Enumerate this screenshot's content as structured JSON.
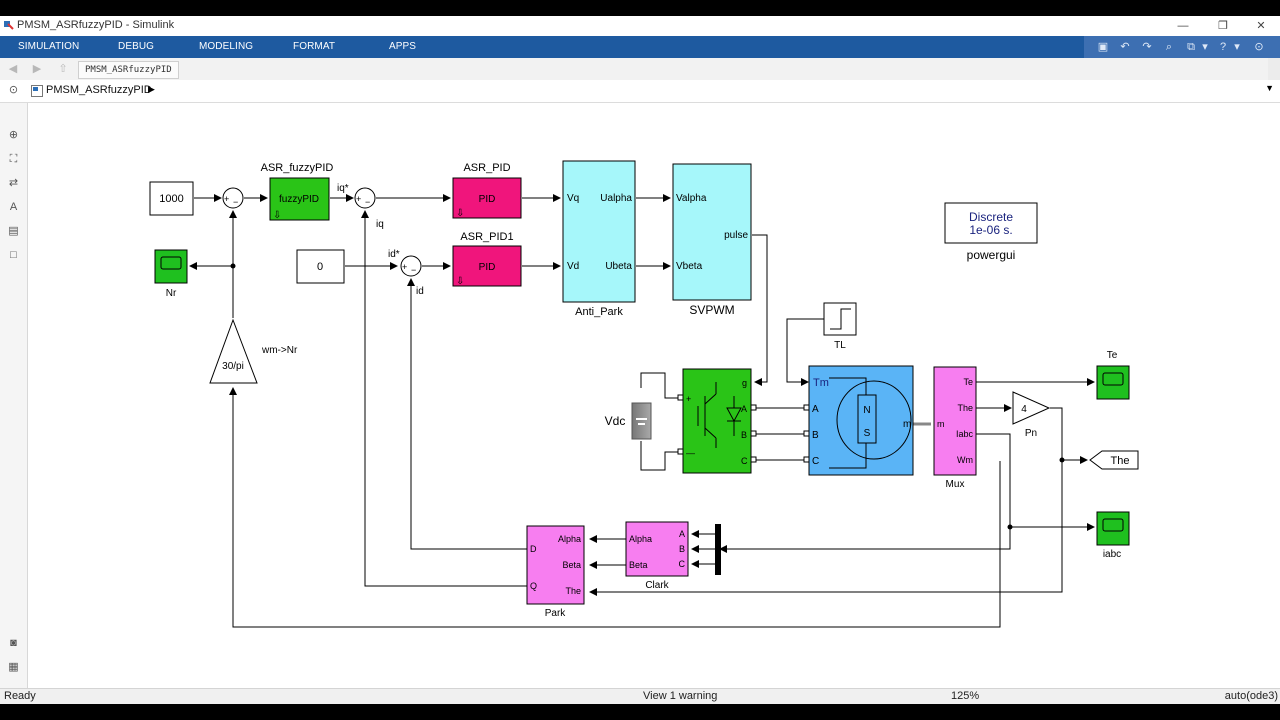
{
  "window": {
    "title": "PMSM_ASRfuzzyPID - Simulink",
    "controls": [
      "—",
      "❐",
      "✕"
    ]
  },
  "menu": [
    "SIMULATION",
    "DEBUG",
    "MODELING",
    "FORMAT",
    "APPS"
  ],
  "tab": {
    "label": "PMSM_ASRfuzzyPID"
  },
  "breadcrumb": {
    "label": "PMSM_ASRfuzzyPID"
  },
  "status": {
    "left": "Ready",
    "warning": "View 1 warning",
    "zoom": "125%",
    "solver": "auto(ode3)"
  },
  "colors": {
    "menubar": "#1e5aa0",
    "pid": "#f0157c",
    "fuzzy": "#2ac417",
    "cyan_block": "#a6f7fa",
    "blue_block": "#5ab4f6",
    "magenta_block": "#f77ef0",
    "scope": "#1fc01f"
  },
  "diagram": {
    "const1000": "1000",
    "const0": "0",
    "fuzzy_title": "ASR_fuzzyPID",
    "fuzzy_body": "fuzzyPID",
    "pid1_title": "ASR_PID",
    "pid2_title": "ASR_PID1",
    "pid_body": "PID",
    "iq_star": "iq*",
    "id_star": "id*",
    "iq": "iq",
    "id": "id",
    "anti_park": {
      "in1": "Vq",
      "in2": "Vd",
      "out1": "Ualpha",
      "out2": "Ubeta",
      "title": "Anti_Park"
    },
    "svpwm": {
      "in1": "Valpha",
      "in2": "Vbeta",
      "out": "pulse",
      "title": "SVPWM"
    },
    "powergui": {
      "line1": "Discrete",
      "line2": "1e-06 s.",
      "title": "powergui"
    },
    "nr": "Nr",
    "gain_wm": {
      "value": "30/pi",
      "label": "wm->Nr"
    },
    "tl": "TL",
    "vdc": "Vdc",
    "inverter": {
      "g": "g",
      "a": "A",
      "b": "B",
      "c": "C",
      "plus": "+",
      "minus": "—"
    },
    "motor": {
      "tm": "Tm",
      "a": "A",
      "b": "B",
      "c": "C",
      "m": "m",
      "n": "N",
      "s": "S"
    },
    "mux": {
      "title": "Mux",
      "m": "m",
      "te": "Te",
      "the": "The",
      "iabc": "Iabc",
      "wm": "Wm"
    },
    "scope_te": "Te",
    "scope_iabc": "iabc",
    "pn": {
      "value": "4",
      "label": "Pn"
    },
    "goto_the": "The",
    "clark": {
      "title": "Clark",
      "alpha": "Alpha",
      "beta": "Beta",
      "a": "A",
      "b": "B",
      "c": "C"
    },
    "park": {
      "title": "Park",
      "alpha": "Alpha",
      "beta": "Beta",
      "the": "The",
      "d": "D",
      "q": "Q"
    },
    "sum_plus": "+",
    "sum_minus": "−"
  }
}
